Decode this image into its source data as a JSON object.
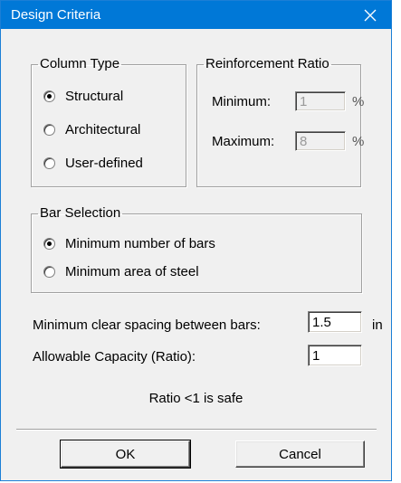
{
  "window": {
    "title": "Design Criteria"
  },
  "column_type": {
    "legend": "Column Type",
    "options": [
      {
        "label": "Structural",
        "selected": true
      },
      {
        "label": "Architectural",
        "selected": false
      },
      {
        "label": "User-defined",
        "selected": false
      }
    ]
  },
  "reinforcement_ratio": {
    "legend": "Reinforcement Ratio",
    "minimum_label": "Minimum:",
    "minimum_value": "1",
    "maximum_label": "Maximum:",
    "maximum_value": "8",
    "unit": "%"
  },
  "bar_selection": {
    "legend": "Bar Selection",
    "options": [
      {
        "label": "Minimum number of bars",
        "selected": true
      },
      {
        "label": "Minimum area of steel",
        "selected": false
      }
    ]
  },
  "spacing": {
    "label": "Minimum clear spacing between bars:",
    "value": "1.5",
    "unit": "in"
  },
  "capacity": {
    "label": "Allowable Capacity (Ratio):",
    "value": "1"
  },
  "note": "Ratio <1 is safe",
  "buttons": {
    "ok": "OK",
    "cancel": "Cancel"
  },
  "icons": {
    "close": "close-icon"
  },
  "colors": {
    "titlebar": "#0078d7",
    "dialog_bg": "#f0f0f0"
  }
}
